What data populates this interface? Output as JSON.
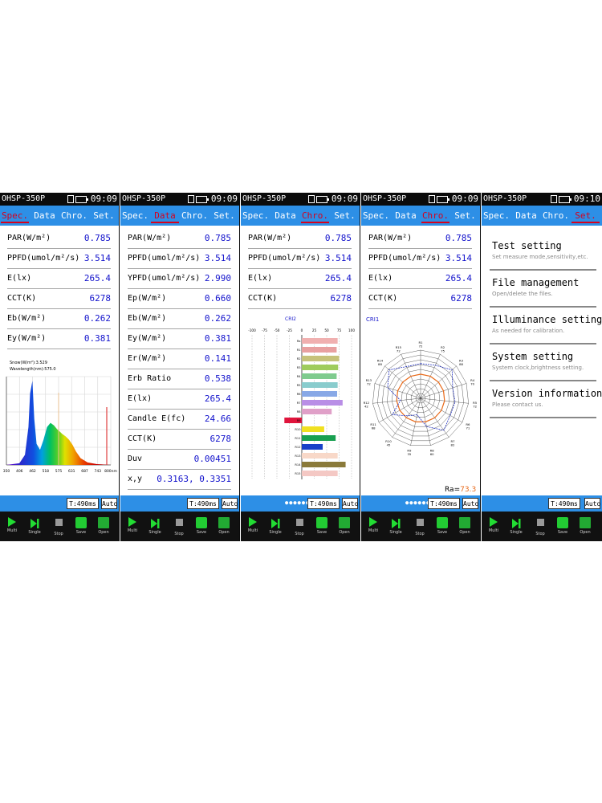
{
  "device": {
    "app_name": "OHSP-350P",
    "clocks": [
      "09:09",
      "09:09",
      "09:09",
      "09:09",
      "09:10"
    ]
  },
  "tabs": [
    "Spec.",
    "Data",
    "Chro.",
    "Set."
  ],
  "footer": {
    "integration_time": "T:490ms",
    "auto_label": "Auto",
    "page_dots": "●●●●●●"
  },
  "toolbar": [
    {
      "label": "Multi",
      "icon": "play-icon"
    },
    {
      "label": "Single",
      "icon": "single-step-icon"
    },
    {
      "label": "Stop",
      "icon": "stop-icon"
    },
    {
      "label": "Save",
      "icon": "save-icon"
    },
    {
      "label": "Open",
      "icon": "open-folder-icon"
    }
  ],
  "spec_screen": {
    "rows": [
      {
        "label": "PAR(W/m²)",
        "value": "0.785"
      },
      {
        "label": "PPFD(umol/m²/s)",
        "value": "3.514"
      },
      {
        "label": "E(lx)",
        "value": "265.4"
      },
      {
        "label": "CCT(K)",
        "value": "6278"
      },
      {
        "label": "Eb(W/m²)",
        "value": "0.262"
      },
      {
        "label": "Ey(W/m²)",
        "value": "0.381"
      }
    ],
    "peak_text": "Snow(W/m²):3.529",
    "wavelength_text": "Wavelength(nm):575.0",
    "x_ticks": [
      "350",
      "406",
      "462",
      "518",
      "575",
      "631",
      "687",
      "743",
      "800nm"
    ]
  },
  "data_screen": {
    "rows": [
      {
        "label": "PAR(W/m²)",
        "value": "0.785"
      },
      {
        "label": "PPFD(umol/m²/s)",
        "value": "3.514"
      },
      {
        "label": "YPFD(umol/m²/s)",
        "value": "2.990"
      },
      {
        "label": "Ep(W/m²)",
        "value": "0.660"
      },
      {
        "label": "Eb(W/m²)",
        "value": "0.262"
      },
      {
        "label": "Ey(W/m²)",
        "value": "0.381"
      },
      {
        "label": "Er(W/m²)",
        "value": "0.141"
      },
      {
        "label": "Erb Ratio",
        "value": "0.538"
      },
      {
        "label": "E(lx)",
        "value": "265.4"
      },
      {
        "label": "Candle E(fc)",
        "value": "24.66"
      },
      {
        "label": "CCT(K)",
        "value": "6278"
      },
      {
        "label": "Duv",
        "value": "0.00451"
      },
      {
        "label": "x,y",
        "value": "0.3163, 0.3351"
      }
    ]
  },
  "chro_screen": {
    "rows": [
      {
        "label": "PAR(W/m²)",
        "value": "0.785"
      },
      {
        "label": "PPFD(umol/m²/s)",
        "value": "3.514"
      },
      {
        "label": "E(lx)",
        "value": "265.4"
      },
      {
        "label": "CCT(K)",
        "value": "6278"
      }
    ],
    "cri_title": "CRI2",
    "x_ticks": [
      "-100",
      "-75",
      "-50",
      "-25",
      "0",
      "25",
      "50",
      "75",
      "100"
    ]
  },
  "polar_screen": {
    "rows": [
      {
        "label": "PAR(W/m²)",
        "value": "0.785"
      },
      {
        "label": "PPFD(umol/m²/s)",
        "value": "3.514"
      },
      {
        "label": "E(lx)",
        "value": "265.4"
      },
      {
        "label": "CCT(K)",
        "value": "6278"
      }
    ],
    "cri_title": "CRI1",
    "ra_label": "Ra=",
    "ra_value": "73.3"
  },
  "settings_screen": {
    "items": [
      {
        "title": "Test setting",
        "subtitle": "Set measure mode,sensitivity,etc."
      },
      {
        "title": "File management",
        "subtitle": "Open/delete the files."
      },
      {
        "title": "Illuminance setting",
        "subtitle": "As needed for calibration."
      },
      {
        "title": "System setting",
        "subtitle": "System clock,brightness setting."
      },
      {
        "title": "Version information",
        "subtitle": "Please contact us."
      }
    ]
  },
  "chart_data": [
    {
      "type": "area",
      "x": [
        350,
        406,
        430,
        445,
        452,
        462,
        470,
        480,
        495,
        510,
        525,
        540,
        555,
        570,
        575,
        590,
        605,
        620,
        635,
        650,
        670,
        700,
        740,
        800
      ],
      "values": [
        0.0,
        0.02,
        0.12,
        0.45,
        0.85,
        1.0,
        0.55,
        0.25,
        0.18,
        0.3,
        0.45,
        0.5,
        0.47,
        0.42,
        0.41,
        0.37,
        0.34,
        0.3,
        0.24,
        0.16,
        0.08,
        0.03,
        0.01,
        0.0
      ],
      "xlim": [
        350,
        800
      ],
      "ylim": [
        0,
        1.05
      ],
      "grid": true
    },
    {
      "type": "bar",
      "title": "CRI2",
      "categories": [
        "Ra",
        "R1",
        "R2",
        "R3",
        "R4",
        "R5",
        "R6",
        "R7",
        "R8",
        "R9",
        "R10",
        "R11",
        "R12",
        "R13",
        "R14",
        "R15"
      ],
      "values": [
        72,
        70,
        75,
        73,
        70,
        72,
        71,
        82,
        60,
        -35,
        45,
        68,
        42,
        72,
        88,
        72
      ],
      "colors": [
        "#f0b0b0",
        "#e8a0a0",
        "#c6c27a",
        "#9fcc5c",
        "#7fcb8e",
        "#89cccd",
        "#88a8e6",
        "#b98ee6",
        "#e0a0c8",
        "#e0143c",
        "#f0e020",
        "#18a050",
        "#1840c8",
        "#f8d8c8",
        "#8a7a3a",
        "#f4c8c4"
      ],
      "xlim": [
        -100,
        100
      ]
    },
    {
      "type": "line",
      "title": "CRI1",
      "categories": [
        "R1",
        "R2",
        "R3",
        "R4",
        "R5",
        "R6",
        "R7",
        "R8",
        "R9",
        "R10",
        "R11",
        "R12",
        "R13",
        "R14",
        "R15"
      ],
      "series": [
        {
          "values": [
            72,
            75,
            88,
            70,
            72,
            71,
            82,
            60,
            35,
            45,
            68,
            42,
            72,
            88,
            72
          ]
        }
      ],
      "reference_ring": 50,
      "summary": {
        "Ra": 73.3
      }
    }
  ]
}
